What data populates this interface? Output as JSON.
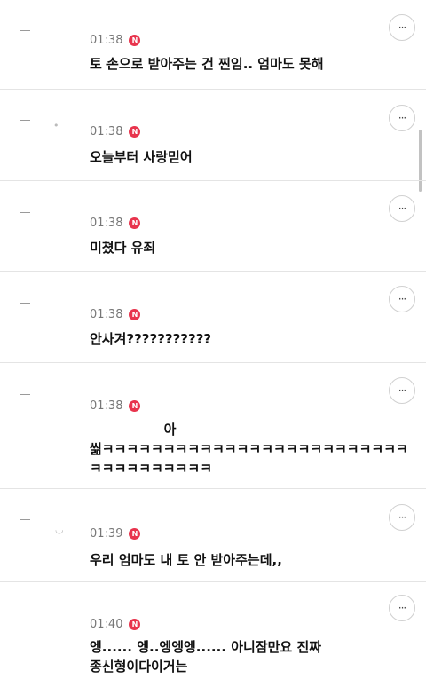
{
  "comments": [
    {
      "time": "01:38",
      "badge": "N",
      "text": "토 손으로 받아주는 건 찐임.. 엄마도 못해",
      "more": "···"
    },
    {
      "time": "01:38",
      "badge": "N",
      "text": "오늘부터 사랑믿어",
      "more": "···"
    },
    {
      "time": "01:38",
      "badge": "N",
      "text": "미쳤다 유죄",
      "more": "···"
    },
    {
      "time": "01:38",
      "badge": "N",
      "text": "안사겨???????????",
      "more": "···"
    },
    {
      "time": "01:38",
      "badge": "N",
      "text": "                아\n씲ㅋㅋㅋㅋㅋㅋㅋㅋㅋㅋㅋㅋㅋㅋㅋㅋㅋㅋㅋㅋㅋㅋㅋㅋㅋ\nㅋㅋㅋㅋㅋㅋㅋㅋㅋㅋ",
      "more": "···"
    },
    {
      "time": "01:39",
      "badge": "N",
      "text": "우리 엄마도 내 토 안 받아주는데,,",
      "more": "···"
    },
    {
      "time": "01:40",
      "badge": "N",
      "text": "엥...... 엥..엥엥엥...... 아니잠만요 진짜\n종신형이다이거는",
      "more": "···"
    }
  ]
}
